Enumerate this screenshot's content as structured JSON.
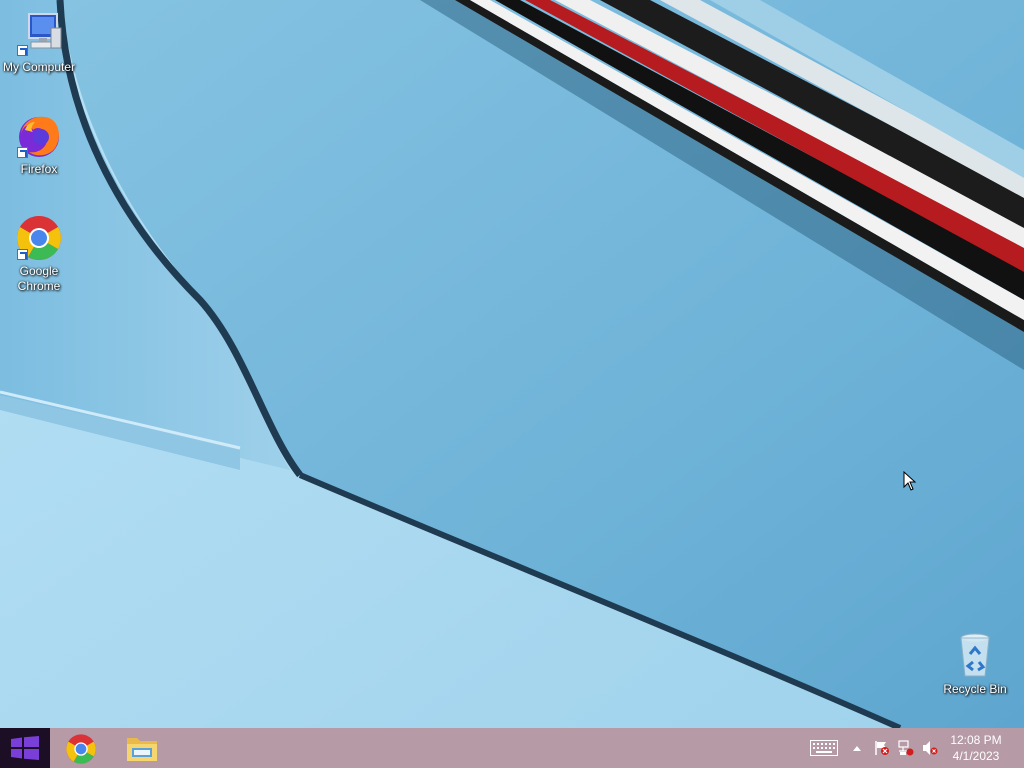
{
  "desktop": {
    "icons": [
      {
        "label": "My Computer",
        "icon": "computer-icon"
      },
      {
        "label": "Firefox",
        "icon": "firefox-icon"
      },
      {
        "label": "Google Chrome",
        "icon": "chrome-icon"
      },
      {
        "label": "Recycle Bin",
        "icon": "recycle-bin-icon"
      }
    ]
  },
  "taskbar": {
    "start_icon": "windows-logo-icon",
    "pinned": [
      {
        "name": "Google Chrome",
        "icon": "chrome-icon"
      },
      {
        "name": "File Explorer",
        "icon": "folder-icon"
      }
    ],
    "tray": {
      "icons": [
        "keyboard-icon",
        "chevron-up-icon",
        "action-center-flag-icon",
        "network-icon",
        "volume-muted-icon"
      ]
    },
    "clock": {
      "time": "12:08 PM",
      "date": "4/1/2023"
    }
  },
  "colors": {
    "taskbar": "#b69aa6",
    "start_button": "#1c0e24",
    "wallpaper_sky": "#a9d9f0",
    "wallpaper_panel": "#72b6d9",
    "stripe_red": "#b51b1f"
  }
}
